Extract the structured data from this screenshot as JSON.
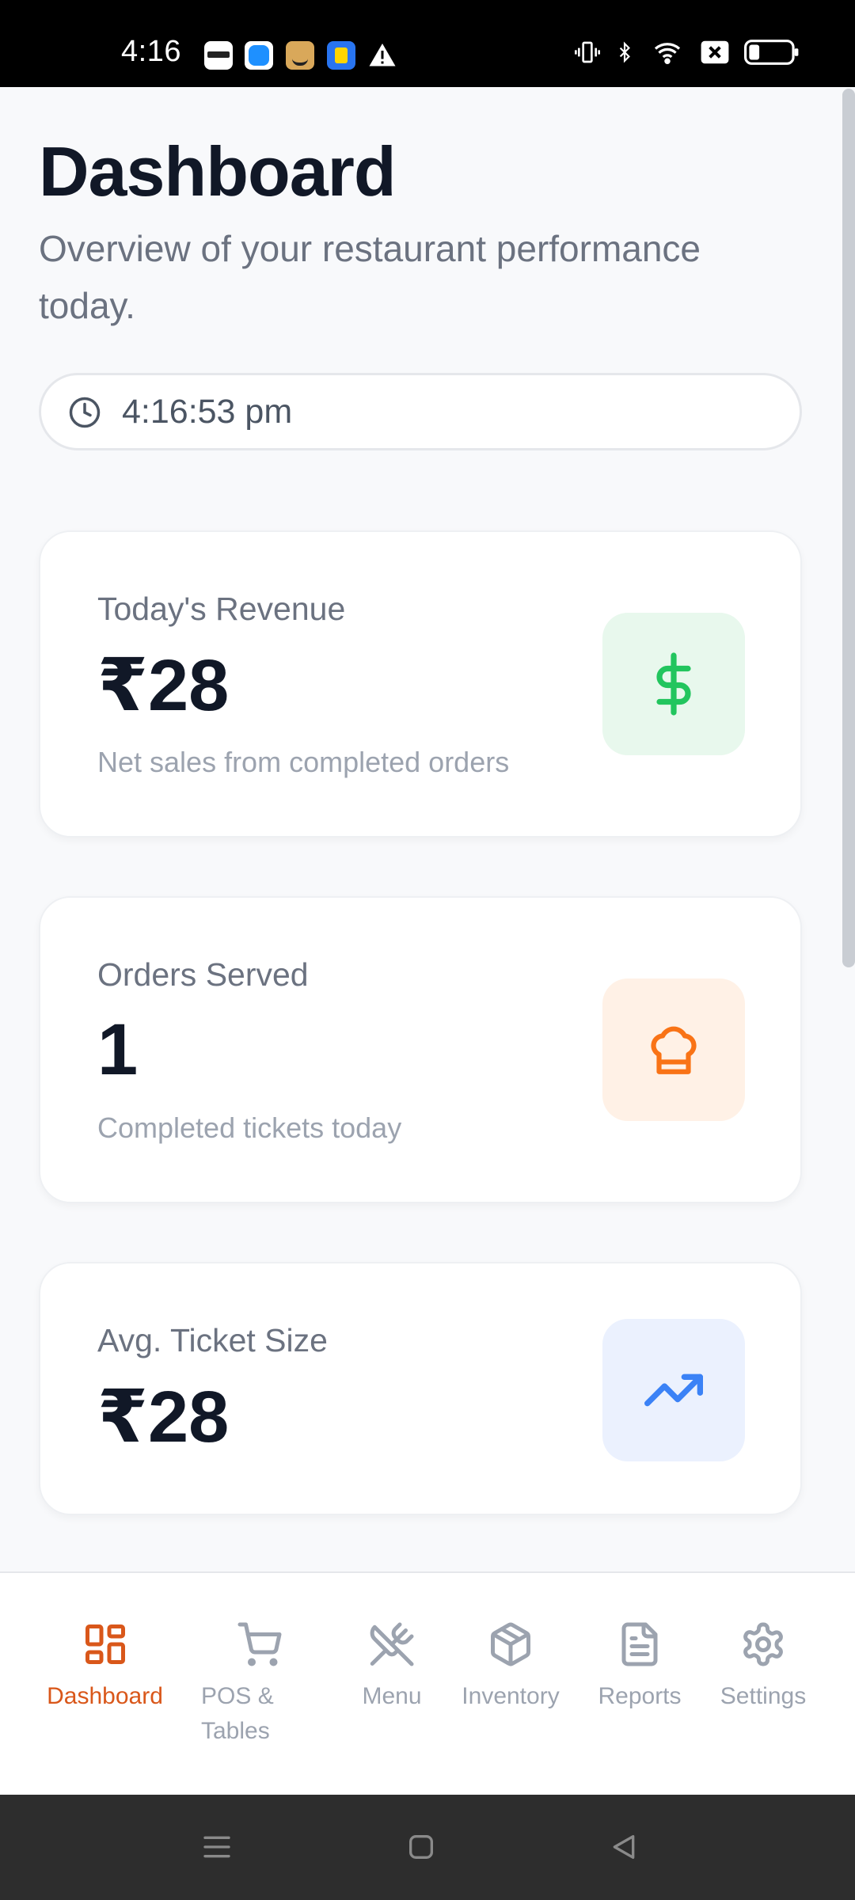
{
  "status_bar": {
    "time": "4:16",
    "app_icons": [
      "zomato-icon",
      "messenger-icon",
      "amazon-icon",
      "flipkart-icon",
      "warning-icon"
    ]
  },
  "header": {
    "title": "Dashboard",
    "subtitle": "Overview of your restaurant performance today."
  },
  "clock": {
    "time": "4:16:53 pm"
  },
  "cards": [
    {
      "label": "Today's Revenue",
      "value": "₹28",
      "description": "Net sales from completed orders",
      "icon": "dollar-icon",
      "icon_color": "#22c55e",
      "icon_bg": "#e8f8ed"
    },
    {
      "label": "Orders Served",
      "value": "1",
      "description": "Completed tickets today",
      "icon": "chef-hat-icon",
      "icon_color": "#f97316",
      "icon_bg": "#fff1e6"
    },
    {
      "label": "Avg. Ticket Size",
      "value": "₹28",
      "description": "",
      "icon": "trending-up-icon",
      "icon_color": "#3b82f6",
      "icon_bg": "#ebf1fe"
    }
  ],
  "bottom_nav": {
    "active_color": "#d9571a",
    "items": [
      {
        "label": "Dashboard",
        "icon": "dashboard-icon"
      },
      {
        "label": "POS & Tables",
        "icon": "cart-icon"
      },
      {
        "label": "Menu",
        "icon": "utensils-icon"
      },
      {
        "label": "Inventory",
        "icon": "box-icon"
      },
      {
        "label": "Reports",
        "icon": "document-icon"
      },
      {
        "label": "Settings",
        "icon": "gear-icon"
      }
    ]
  }
}
